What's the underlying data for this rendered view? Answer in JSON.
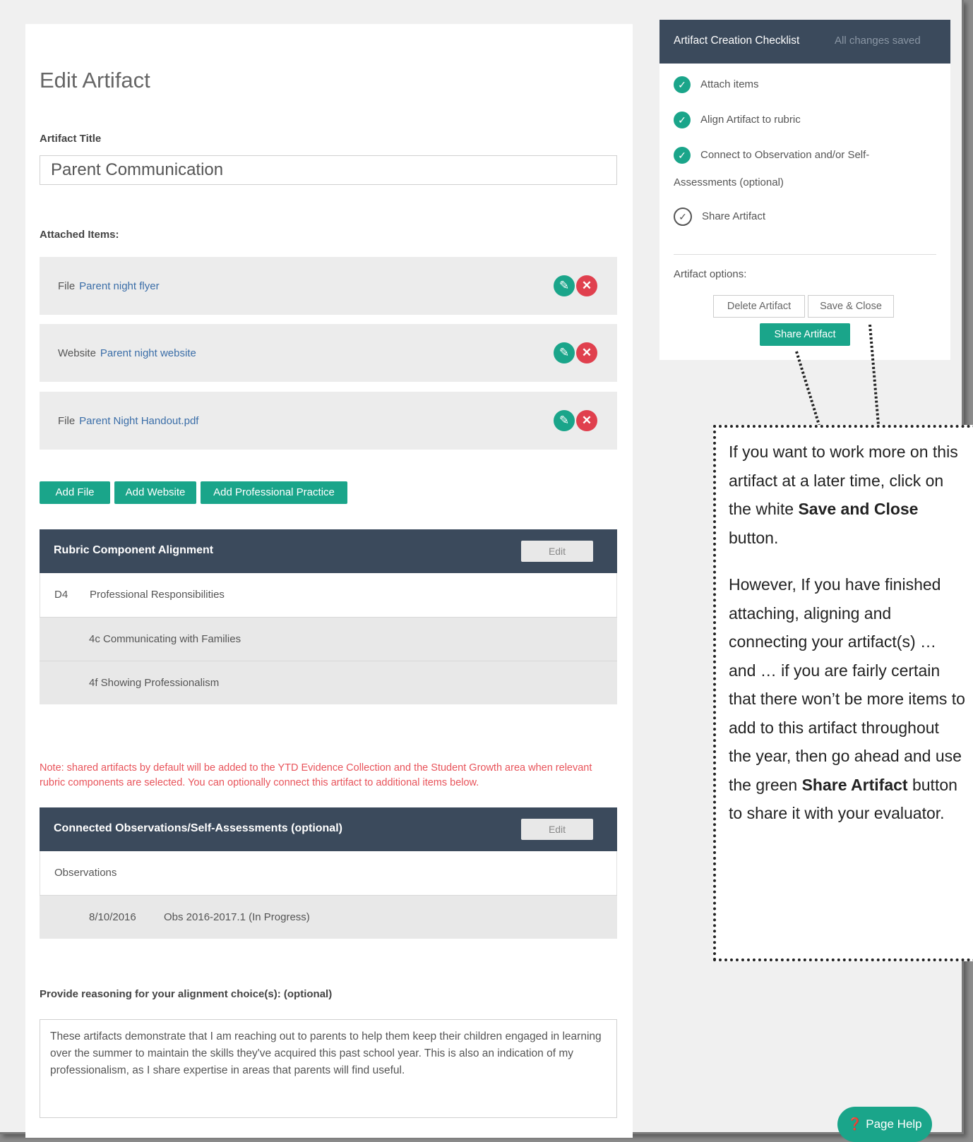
{
  "page_title": "Edit Artifact",
  "artifact_title_label": "Artifact Title",
  "artifact_title_value": "Parent Communication",
  "attached_label": "Attached Items:",
  "attached_items": [
    {
      "kind": "File",
      "name": "Parent night flyer"
    },
    {
      "kind": "Website",
      "name": "Parent night website"
    },
    {
      "kind": "File",
      "name": "Parent Night Handout.pdf"
    }
  ],
  "add_buttons": {
    "file": "Add File",
    "website": "Add Website",
    "practice": "Add Professional Practice"
  },
  "rubric": {
    "title": "Rubric Component Alignment",
    "edit": "Edit",
    "domain_code": "D4",
    "domain_name": "Professional Responsibilities",
    "components": [
      "4c Communicating with Families",
      "4f Showing Professionalism"
    ]
  },
  "note": "Note: shared artifacts by default will be added to the YTD Evidence Collection and the Student Growth area when relevant rubric components are selected. You can optionally connect this artifact to additional items below.",
  "connected": {
    "title": "Connected Observations/Self-Assessments (optional)",
    "edit": "Edit",
    "section": "Observations",
    "date": "8/10/2016",
    "obs": "Obs 2016-2017.1 (In Progress)"
  },
  "reasoning_label": "Provide reasoning for your alignment choice(s): (optional)",
  "reasoning_text": "These artifacts demonstrate that I am reaching out to parents to help them keep their children engaged in learning over the summer to maintain the skills they've acquired this past school year. This is also an indication of my professionalism, as I share expertise in areas that parents will find useful.",
  "checklist": {
    "title": "Artifact Creation Checklist",
    "status": "All changes saved",
    "items": [
      "Attach items",
      "Align Artifact to rubric",
      "Connect to Observation and/or Self-",
      "Assessments (optional)",
      "Share Artifact"
    ],
    "options_label": "Artifact options:",
    "delete": "Delete Artifact",
    "save_close": "Save & Close",
    "share": "Share Artifact"
  },
  "callout": {
    "p1a": "If you want to work more on this artifact at a later time, click on the white ",
    "p1b": "Save and Close",
    "p1c": " button.",
    "p2a": "However, If you have finished attaching, aligning and connecting your artifact(s) … and … if you are fairly certain that there won’t be more items to add to this artifact throughout the year, then go ahead and use the green ",
    "p2b": "Share Artifact",
    "p2c": " button to share it with your evaluator."
  },
  "help": "Page Help"
}
